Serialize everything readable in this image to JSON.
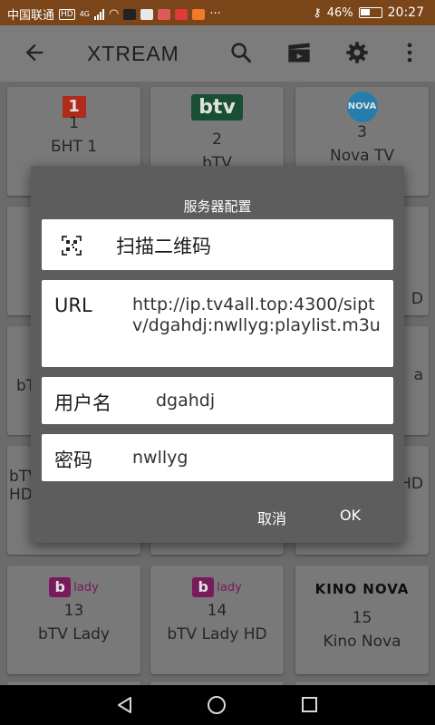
{
  "status_bar": {
    "carrier": "中国联通",
    "hd_badge": "HD",
    "network": "4G",
    "battery_percent": "46%",
    "time": "20:27",
    "more": "···"
  },
  "toolbar": {
    "title": "XTREAM",
    "icons": [
      "back-arrow-icon",
      "search-icon",
      "clapperboard-icon",
      "gear-icon",
      "more-vert-icon"
    ]
  },
  "channels": [
    {
      "number": "1",
      "name": "БНТ 1",
      "logo": "1"
    },
    {
      "number": "2",
      "name": "bTV",
      "logo": "btv"
    },
    {
      "number": "3",
      "name": "Nova TV",
      "logo": "NOVA"
    },
    {
      "number": "13",
      "name": "bTV Lady",
      "logo": "lady"
    },
    {
      "number": "14",
      "name": "bTV Lady HD",
      "logo": "lady"
    },
    {
      "number": "15",
      "name": "Kino Nova",
      "logo": "KINO NOVA"
    }
  ],
  "partial_cards": {
    "left_row3_text": "bT",
    "left_row4_text": "bTV\nHD",
    "right_row2_text": "D",
    "right_row3_text": "a",
    "right_row4_text": "HD"
  },
  "dialog": {
    "title": "服务器配置",
    "scan_label": "扫描二维码",
    "url_label": "URL",
    "url_value": "http://ip.tv4all.top:4300/siptv/dgahdj:nwllyg:playlist.m3u",
    "username_label": "用户名",
    "username_value": "dgahdj",
    "password_label": "密码",
    "password_value": "nwllyg",
    "cancel_label": "取消",
    "ok_label": "OK"
  },
  "colors": {
    "status_bar": "#7a4519",
    "dialog_bg": "#5d5d5d",
    "bnt_red": "#c8321e",
    "btv_green": "#1c5a3a",
    "nova_blue": "#2a8fc4",
    "lady_purple": "#8a1e6a"
  }
}
